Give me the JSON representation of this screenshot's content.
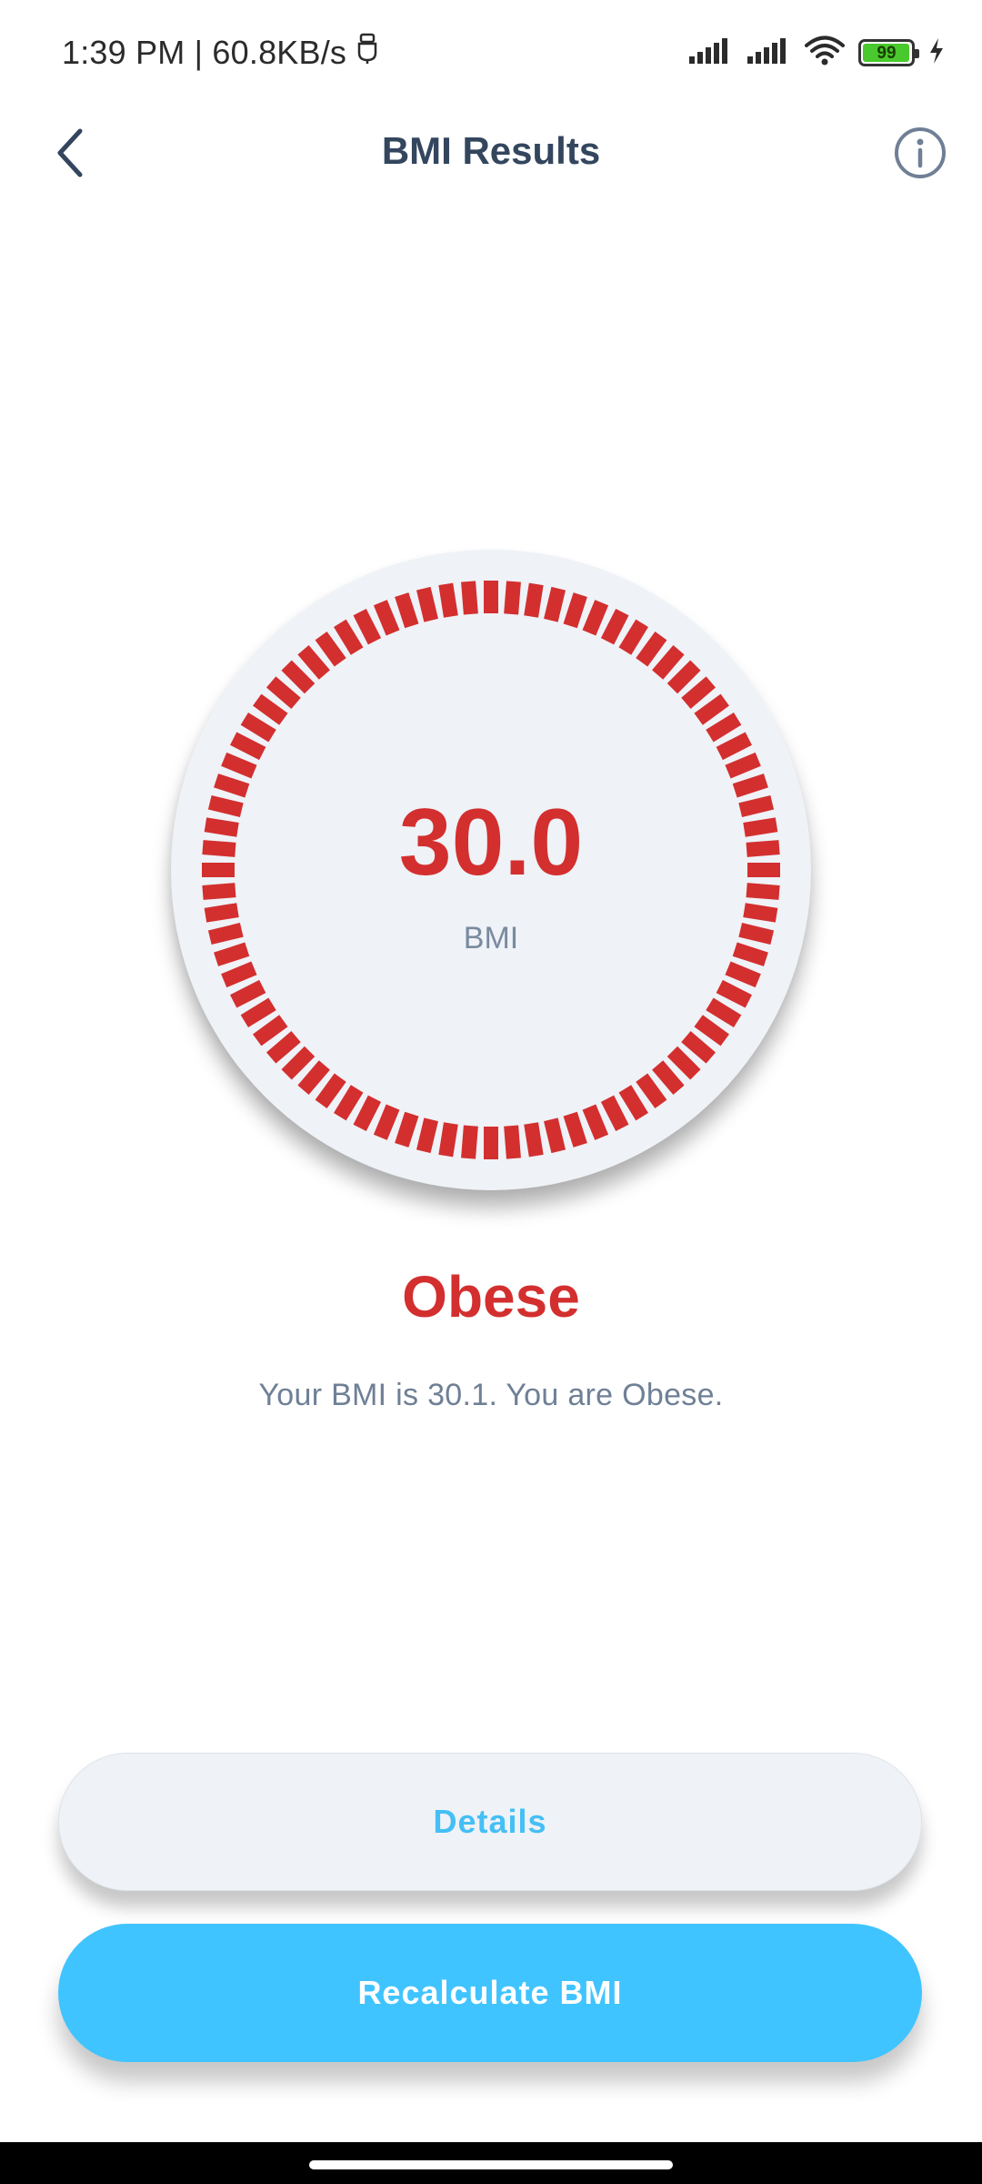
{
  "status_bar": {
    "time_speed": "1:39 PM | 60.8KB/s",
    "battery_level": "99",
    "battery_fraction": 0.99,
    "icons": [
      "usb-icon",
      "signal-icon",
      "signal-icon",
      "wifi-icon",
      "battery-icon",
      "charging-icon"
    ]
  },
  "header": {
    "title": "BMI Results",
    "back_icon": "chevron-left-icon",
    "info_icon": "info-icon"
  },
  "gauge": {
    "value": "30.0",
    "unit": "BMI",
    "tick_count": 80,
    "color": "#d32f2f"
  },
  "result": {
    "category": "Obese",
    "description": "Your BMI is 30.1. You are Obese."
  },
  "buttons": {
    "details": "Details",
    "recalculate": "Recalculate BMI"
  },
  "colors": {
    "accent": "#40c4ff",
    "danger": "#d32f2f",
    "title": "#33465e",
    "gauge_background": "#eff2f7"
  }
}
